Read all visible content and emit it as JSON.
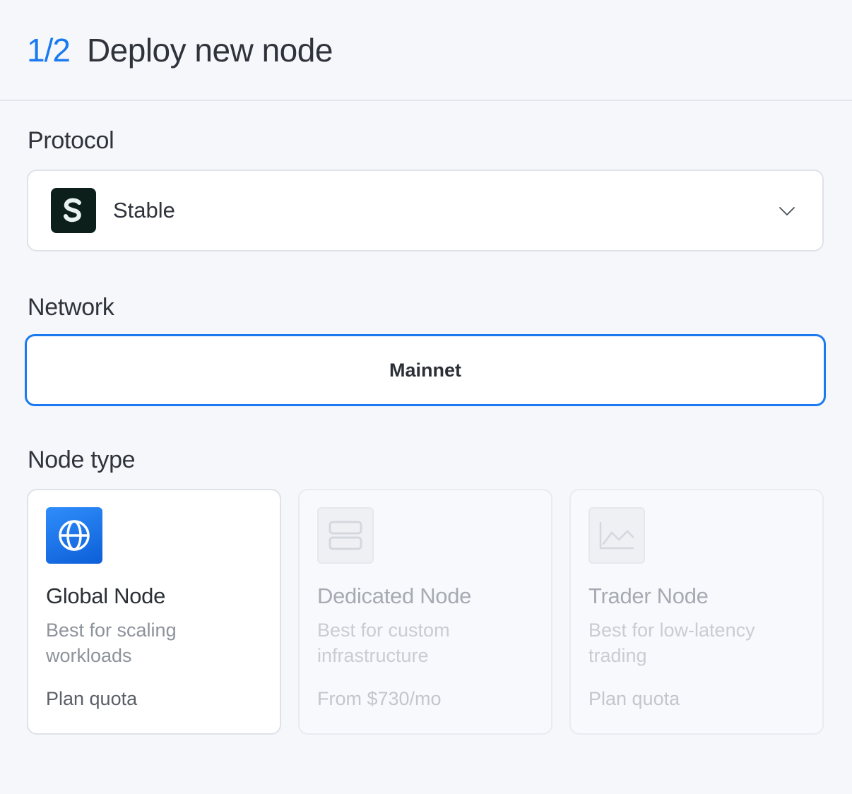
{
  "header": {
    "step": "1/2",
    "title": "Deploy new node"
  },
  "protocol": {
    "label": "Protocol",
    "selected": "Stable",
    "icon": "stable-logo",
    "dropdown_icon": "chevron-down-icon"
  },
  "network": {
    "label": "Network",
    "selected": "Mainnet"
  },
  "node_type": {
    "label": "Node type",
    "options": [
      {
        "title": "Global Node",
        "description": "Best for scaling workloads",
        "price": "Plan quota",
        "icon": "globe-icon",
        "state": "selected"
      },
      {
        "title": "Dedicated Node",
        "description": "Best for custom infrastructure",
        "price": "From $730/mo",
        "icon": "server-icon",
        "state": "disabled"
      },
      {
        "title": "Trader Node",
        "description": "Best for low-latency trading",
        "price": "Plan quota",
        "icon": "chart-icon",
        "state": "disabled"
      }
    ]
  },
  "colors": {
    "accent": "#1a7af0",
    "background": "#f6f7fb",
    "stable_logo_bg": "#0d1f1b"
  }
}
